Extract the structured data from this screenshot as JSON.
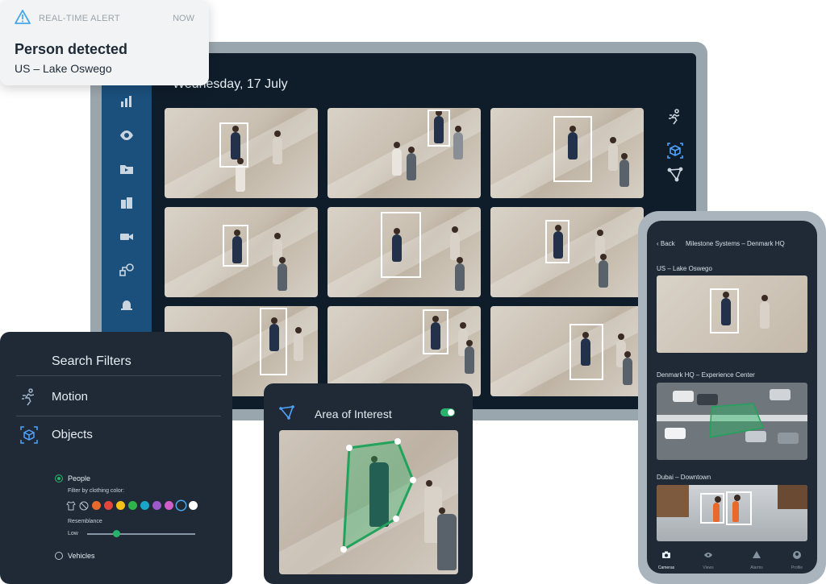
{
  "alert": {
    "label": "REAL-TIME ALERT",
    "time": "NOW",
    "title": "Person detected",
    "location": "US – Lake Oswego"
  },
  "monitor": {
    "date": "Wednesday, 17 July",
    "sidebar_icons": [
      "chart-icon",
      "eye-icon",
      "folder-icon",
      "buildings-icon",
      "camera-icon",
      "workflow-icon",
      "alarm-icon",
      "users-icon"
    ],
    "tools": [
      "motion-icon",
      "object-icon",
      "area-icon"
    ]
  },
  "filters": {
    "title": "Search Filters",
    "motion_label": "Motion",
    "objects_label": "Objects",
    "people_label": "People",
    "clothing_label": "Filter by clothing color:",
    "resemblance_label": "Resemblance",
    "low_label": "Low",
    "vehicles_label": "Vehicles",
    "colors": [
      "#e8692c",
      "#e0463c",
      "#f2c21b",
      "#2fb24c",
      "#1aa6c9",
      "#9b59c9",
      "#d05ec8",
      "#1d2a36",
      "#ffffff"
    ]
  },
  "aoi": {
    "title": "Area of Interest"
  },
  "phone": {
    "back_label": "Back",
    "title": "Milestone Systems – Denmark HQ",
    "cams": [
      {
        "label": "US – Lake Oswego"
      },
      {
        "label": "Denmark HQ – Experience Center"
      },
      {
        "label": "Dubai – Downtown"
      }
    ],
    "nav": [
      {
        "label": "Cameras",
        "icon": "camera-icon"
      },
      {
        "label": "Views",
        "icon": "eye-icon"
      },
      {
        "label": "Alarms",
        "icon": "alarm-icon"
      },
      {
        "label": "Profile",
        "icon": "profile-icon"
      }
    ]
  }
}
